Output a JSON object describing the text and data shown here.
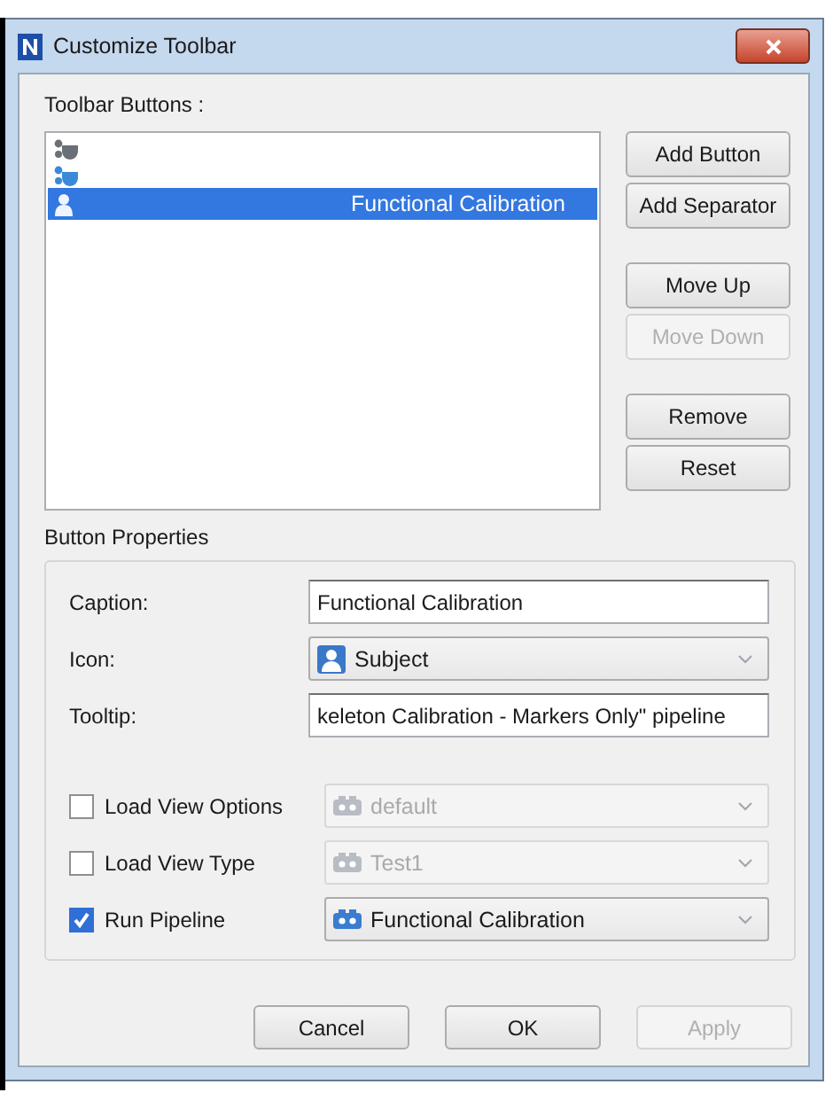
{
  "window": {
    "title": "Customize Toolbar"
  },
  "toolbar_buttons": {
    "label": "Toolbar Buttons :",
    "items": [
      {
        "kind": "group",
        "color": "#6a7078",
        "selected": false
      },
      {
        "kind": "group",
        "color": "#3a8ad8",
        "selected": false
      },
      {
        "kind": "person",
        "label": "Functional Calibration",
        "selected": true
      }
    ]
  },
  "side_button_groups": [
    [
      {
        "label": "Add Button",
        "disabled": false
      },
      {
        "label": "Add Separator",
        "disabled": false
      }
    ],
    [
      {
        "label": "Move Up",
        "disabled": false
      },
      {
        "label": "Move Down",
        "disabled": true
      }
    ],
    [
      {
        "label": "Remove",
        "disabled": false
      },
      {
        "label": "Reset",
        "disabled": false
      }
    ]
  ],
  "button_properties": {
    "title": "Button Properties",
    "fields": [
      {
        "kind": "text",
        "label": "Caption:",
        "value": "Functional Calibration"
      },
      {
        "kind": "combo",
        "label": "Icon:",
        "value": "Subject"
      },
      {
        "kind": "text",
        "label": "Tooltip:",
        "value": "keleton Calibration - Markers Only\" pipeline"
      }
    ],
    "options": [
      {
        "label": "Load View Options",
        "checked": false,
        "value": "default",
        "disabled": true
      },
      {
        "label": "Load View Type",
        "checked": false,
        "value": "Test1",
        "disabled": true
      },
      {
        "label": "Run Pipeline",
        "checked": true,
        "value": "Functional Calibration",
        "disabled": false
      }
    ]
  },
  "buttons": [
    {
      "label": "Cancel",
      "disabled": false
    },
    {
      "label": "OK",
      "disabled": false
    },
    {
      "label": "Apply",
      "disabled": true
    }
  ]
}
